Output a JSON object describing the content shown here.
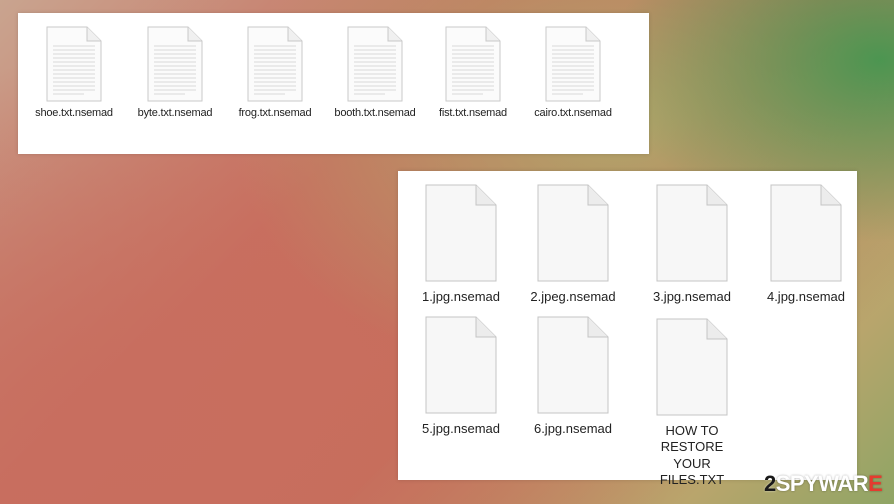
{
  "top_panel": {
    "files": [
      {
        "name": "shoe.txt.nsemad",
        "icon": "text-document-icon"
      },
      {
        "name": "byte.txt.nsemad",
        "icon": "text-document-icon"
      },
      {
        "name": "frog.txt.nsemad",
        "icon": "text-document-icon"
      },
      {
        "name": "booth.txt.nsemad",
        "icon": "text-document-icon"
      },
      {
        "name": "fist.txt.nsemad",
        "icon": "text-document-icon"
      },
      {
        "name": "cairo.txt.nsemad",
        "icon": "text-document-icon"
      }
    ]
  },
  "bottom_panel": {
    "files": [
      {
        "name": "1.jpg.nsemad",
        "icon": "blank-file-icon"
      },
      {
        "name": "2.jpeg.nsemad",
        "icon": "blank-file-icon"
      },
      {
        "name": "3.jpg.nsemad",
        "icon": "blank-file-icon"
      },
      {
        "name": "4.jpg.nsemad",
        "icon": "blank-file-icon"
      },
      {
        "name": "5.jpg.nsemad",
        "icon": "blank-file-icon"
      },
      {
        "name": "6.jpg.nsemad",
        "icon": "blank-file-icon"
      },
      {
        "name": "HOW TO RESTORE YOUR FILES.TXT",
        "icon": "blank-file-icon"
      }
    ]
  },
  "watermark": {
    "num": "2",
    "brand": "SPYWAR",
    "accent": "E"
  },
  "colors": {
    "panel_bg": "#ffffff",
    "label_text": "#222222",
    "icon_border": "#c9c9c9",
    "icon_lines": "#d8d8d8",
    "watermark_accent": "#e53b2f"
  }
}
